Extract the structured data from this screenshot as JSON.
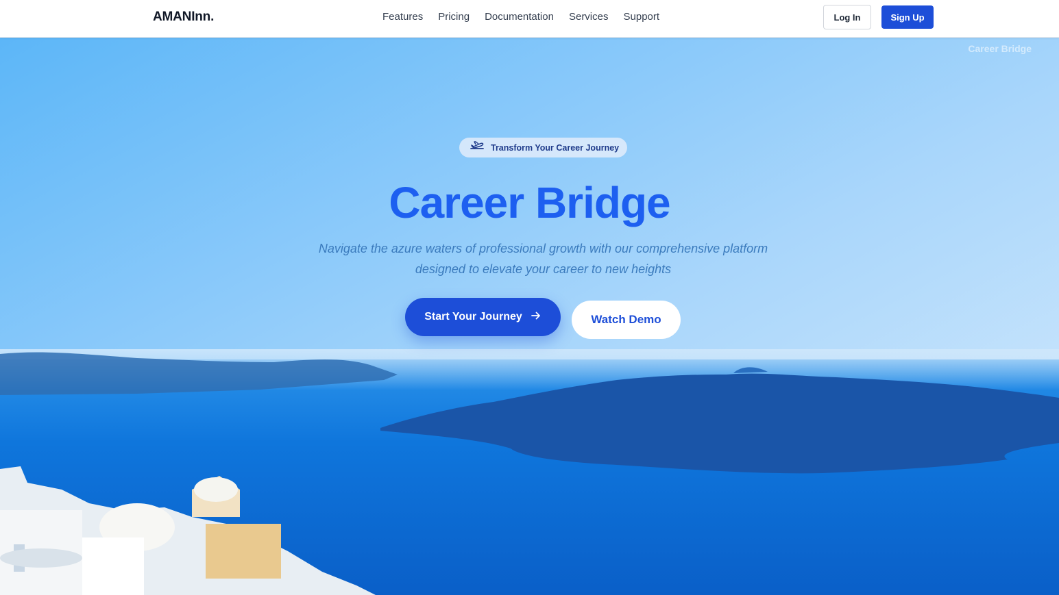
{
  "nav": {
    "brand": "AMANInn.",
    "links": [
      "Features",
      "Pricing",
      "Documentation",
      "Services",
      "Support"
    ],
    "login_label": "Log In",
    "signup_label": "Sign Up"
  },
  "hero": {
    "watermark": "Career Bridge",
    "badge": {
      "icon": "airplane-takeoff-icon",
      "text": "Transform Your Career Journey"
    },
    "title": "Career Bridge",
    "subtitle_line1": "Navigate the azure waters of professional growth with our comprehensive platform",
    "subtitle_line2": "designed to elevate your career to new heights",
    "primary_cta": {
      "label": "Start Your Journey",
      "icon": "arrow-right-icon"
    },
    "secondary_cta": {
      "label": "Watch Demo"
    }
  },
  "colors": {
    "primary": "#1d4ed8",
    "title": "#1d5ff0",
    "subtitle": "#3b7bbd",
    "sky_top": "#5cb6f8",
    "sea": "#0b6fd6"
  }
}
